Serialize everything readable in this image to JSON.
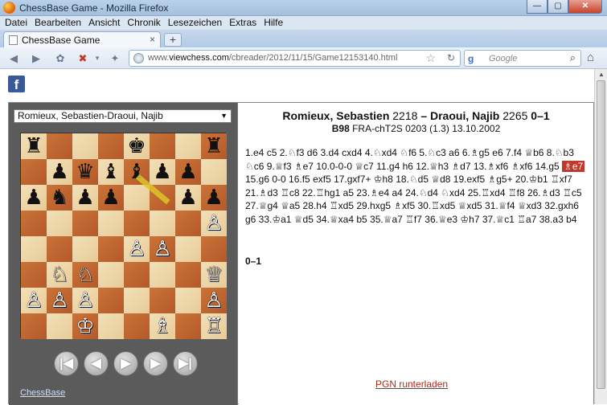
{
  "window": {
    "title": "ChessBase Game - Mozilla Firefox",
    "min": "—",
    "max": "▢",
    "close": "✕"
  },
  "menu": [
    "Datei",
    "Bearbeiten",
    "Ansicht",
    "Chronik",
    "Lesezeichen",
    "Extras",
    "Hilfe"
  ],
  "tab": {
    "label": "ChessBase Game",
    "close": "×",
    "new": "+"
  },
  "nav": {
    "url_prefix": "www.",
    "url_domain": "viewchess.com",
    "url_path": "/cbreader/2012/11/15/Game12153140.html",
    "search_placeholder": "Google",
    "icons": [
      "back-icon",
      "forward-icon",
      "addon-icon",
      "block-icon",
      "bookmark-icon",
      "home-icon"
    ]
  },
  "page": {
    "facebook": "f",
    "game_select": "Romieux, Sebastien-Draoui, Najib",
    "header": {
      "white": "Romieux, Sebastien",
      "white_elo": "2218",
      "dash": "–",
      "black": "Draoui, Najib",
      "black_elo": "2265",
      "result": "0–1",
      "eco": "B98",
      "event": "FRA-chT2S 0203",
      "round": "(1.3)",
      "date": "13.10.2002"
    },
    "moves_before": "1.e4 c5 2.♘f3 d6 3.d4 cxd4 4.♘xd4 ♘f6 5.♘c3 a6 6.♗g5 e6 7.f4 ♕b6 8.♘b3 ♘c6 9.♕f3 ♗e7 10.0-0-0 ♕c7 11.g4 h6 12.♕h3 ♗d7 13.♗xf6 ♗xf6 14.g5 ",
    "current_move": "♗e7",
    "moves_after": " 15.g6 0-0 16.f5 exf5 17.gxf7+ ♔h8 18.♘d5 ♕d8 19.exf5 ♗g5+ 20.♔b1 ♖xf7 21.♗d3 ♖c8 22.♖hg1 a5 23.♗e4 a4 24.♘d4 ♘xd4 25.♖xd4 ♖f8 26.♗d3 ♖c5 27.♕g4 ♕a5 28.h4 ♖xd5 29.hxg5 ♗xf5 30.♖xd5 ♕xd5 31.♕f4 ♕xd3 32.gxh6 g6 33.♔a1 ♕d5 34.♕xa4 b5 35.♕a7 ♖f7 36.♕e3 ♔h7 37.♕c1 ♖a7 38.a3 b4",
    "final_result": "0–1",
    "pgn_link": "PGN runterladen",
    "chessbase_link": "ChessBase",
    "board": [
      [
        "♜",
        "",
        "",
        "",
        "♚",
        "",
        "",
        "♜"
      ],
      [
        "",
        "♟",
        "♛",
        "♝",
        "♝",
        "♟",
        "♟",
        ""
      ],
      [
        "♟",
        "♞",
        "♟",
        "♟",
        "",
        "",
        "♟",
        "♟"
      ],
      [
        "",
        "",
        "",
        "",
        "",
        "",
        "",
        "♙"
      ],
      [
        "",
        "",
        "",
        "",
        "♙",
        "♙",
        "",
        ""
      ],
      [
        "",
        "♘",
        "♘",
        "",
        "",
        "",
        "",
        "♕"
      ],
      [
        "♙",
        "♙",
        "♙",
        "",
        "",
        "",
        "",
        "♙"
      ],
      [
        "",
        "",
        "♔",
        "",
        "",
        "♗",
        "",
        "♖"
      ]
    ],
    "board_white_pieces": [
      [
        false,
        false,
        false,
        false,
        false,
        false,
        false,
        false
      ],
      [
        false,
        false,
        false,
        false,
        false,
        false,
        false,
        false
      ],
      [
        false,
        false,
        false,
        false,
        false,
        false,
        false,
        false
      ],
      [
        false,
        false,
        false,
        false,
        false,
        false,
        false,
        true
      ],
      [
        false,
        false,
        false,
        false,
        true,
        true,
        false,
        false
      ],
      [
        false,
        true,
        true,
        false,
        false,
        false,
        false,
        true
      ],
      [
        true,
        true,
        true,
        false,
        false,
        false,
        false,
        true
      ],
      [
        false,
        false,
        true,
        false,
        false,
        true,
        false,
        true
      ]
    ],
    "controls": [
      "first-move-icon",
      "previous-move-icon",
      "play-icon",
      "next-move-icon",
      "last-move-icon"
    ],
    "control_glyphs": [
      "|◀",
      "◀",
      "▶",
      "▶",
      "▶|"
    ]
  }
}
